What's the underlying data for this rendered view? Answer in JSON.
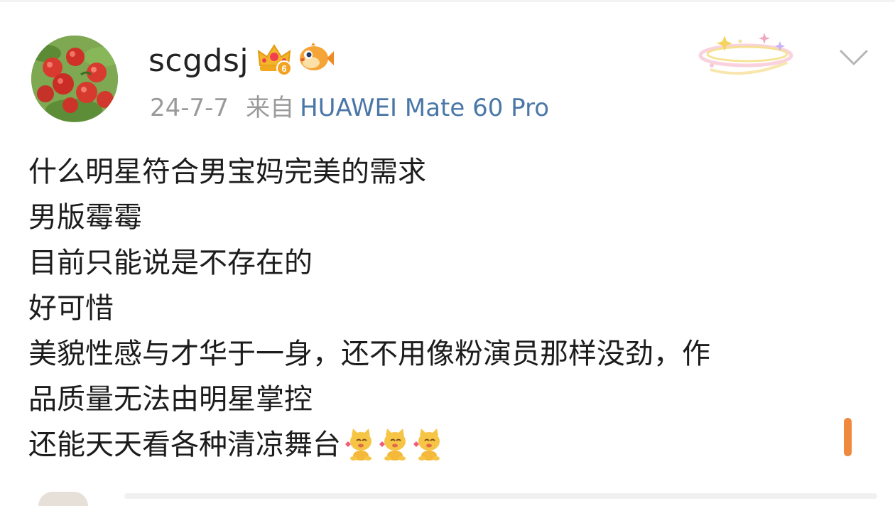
{
  "post": {
    "username": "scgdsj",
    "date": "24-7-7",
    "from_label": "来自",
    "device": "HUAWEI Mate 60 Pro",
    "badge_level": "6",
    "content_lines": [
      "什么明星符合男宝妈完美的需求",
      "男版霉霉",
      "目前只能说是不存在的",
      "好可惜",
      "美貌性感与才华于一身，还不用像粉演员那样没劲，作",
      "品质量无法由明星掌控",
      "还能天天看各种清凉舞台"
    ]
  },
  "icons": {
    "avatar": "apple-orchard-avatar",
    "badge": "crown-level-icon",
    "member": "pufferfish-icon",
    "decor": "sparkle-ring-decoration",
    "menu": "chevron-down-icon",
    "emoji": "cat-heart-emoji"
  },
  "colors": {
    "device_link": "#4a77a8",
    "meta_gray": "#9a9a9a",
    "scroll_accent": "#f0893c"
  }
}
